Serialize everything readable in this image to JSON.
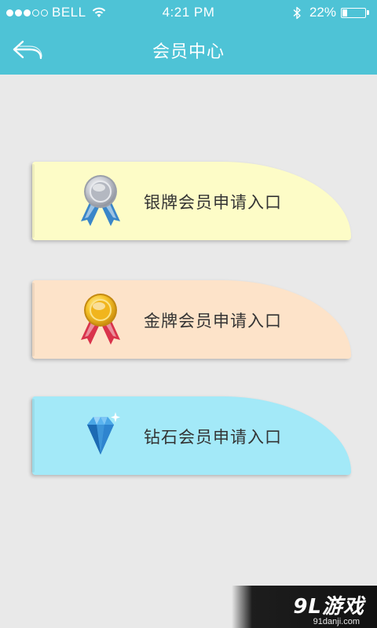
{
  "status_bar": {
    "carrier": "BELL",
    "time": "4:21 PM",
    "battery_percent": "22%",
    "battery_level": 0.22,
    "signal_bars": 3,
    "icons": [
      "wifi-icon",
      "bluetooth-icon",
      "battery-icon"
    ]
  },
  "header": {
    "title": "会员中心",
    "background": "#4ec3d6",
    "back_icon": "back-arrow-icon"
  },
  "cards": [
    {
      "label": "银牌会员申请入口",
      "icon": "silver-medal-icon",
      "background": "#fdfcc7"
    },
    {
      "label": "金牌会员申请入口",
      "icon": "gold-medal-icon",
      "background": "#fde3c9"
    },
    {
      "label": "钻石会员申请入口",
      "icon": "diamond-icon",
      "background": "#a3e9f8"
    }
  ],
  "watermark": {
    "logo_text": "9L游戏",
    "url": "91danji.com"
  }
}
